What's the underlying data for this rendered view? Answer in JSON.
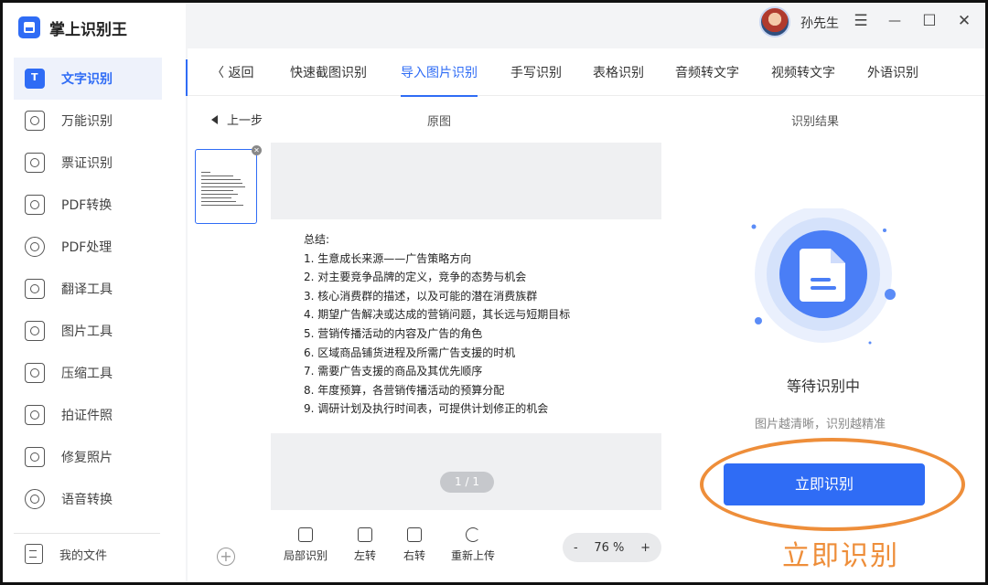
{
  "app": {
    "title": "掌上识别王"
  },
  "user": {
    "name": "孙先生"
  },
  "window_controls": {
    "menu": "☰",
    "minimize": "—",
    "maximize": "☐",
    "close": "✕"
  },
  "sidebar": {
    "items": [
      {
        "label": "文字识别"
      },
      {
        "label": "万能识别"
      },
      {
        "label": "票证识别"
      },
      {
        "label": "PDF转换"
      },
      {
        "label": "PDF处理"
      },
      {
        "label": "翻译工具"
      },
      {
        "label": "图片工具"
      },
      {
        "label": "压缩工具"
      },
      {
        "label": "拍证件照"
      },
      {
        "label": "修复照片"
      },
      {
        "label": "语音转换"
      }
    ],
    "my_files": "我的文件"
  },
  "tabs": {
    "back": "返回",
    "items": [
      "快速截图识别",
      "导入图片识别",
      "手写识别",
      "表格识别",
      "音频转文字",
      "视频转文字",
      "外语识别"
    ]
  },
  "preview": {
    "prev_step": "上一步",
    "original_title": "原图",
    "document_lines": [
      "总结:",
      "1. 生意成长来源——广告策略方向",
      "2. 对主要竞争品牌的定义，竞争的态势与机会",
      "3. 核心消费群的描述，以及可能的潜在消费族群",
      "4. 期望广告解决或达成的营销问题，其长远与短期目标",
      "5. 营销传播活动的内容及广告的角色",
      "6. 区域商品铺货进程及所需广告支援的时机",
      "7. 需要广告支援的商品及其优先顺序",
      "8. 年度预算，各营销传播活动的预算分配",
      "9. 调研计划及执行时间表，可提供计划修正的机会"
    ],
    "page_indicator": "1 / 1",
    "tools": {
      "partial": "局部识别",
      "rotate_left": "左转",
      "rotate_right": "右转",
      "reupload": "重新上传"
    },
    "zoom": {
      "minus": "-",
      "value": "76 %",
      "plus": "+"
    },
    "add": "+"
  },
  "result": {
    "title": "识别结果",
    "status": "等待识别中",
    "hint": "图片越清晰，识别越精准",
    "button": "立即识别"
  },
  "annotation": {
    "label": "立即识别",
    "color": "#ee8e3a"
  },
  "colors": {
    "accent": "#2f6cf5"
  }
}
